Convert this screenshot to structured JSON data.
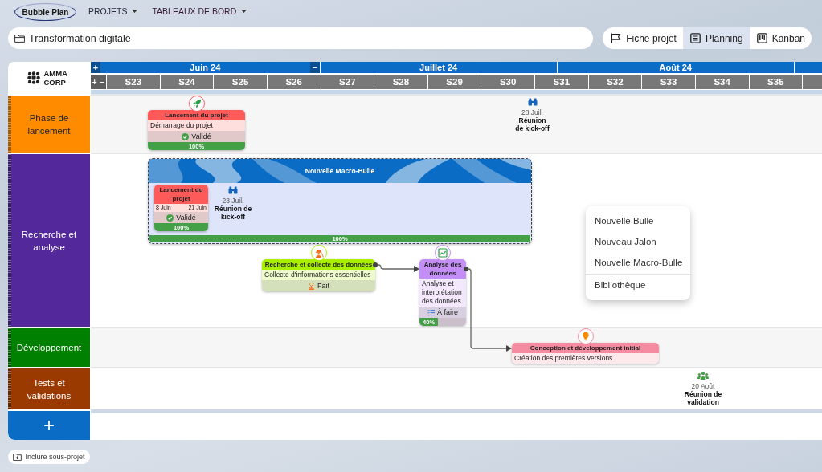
{
  "nav": {
    "logo": "Bubble Plan",
    "menus": [
      {
        "label": "PROJETS"
      },
      {
        "label": "TABLEAUX DE BORD"
      }
    ]
  },
  "project_field": {
    "value": "Transformation digitale"
  },
  "views": [
    {
      "label": "Fiche projet",
      "selected": false
    },
    {
      "label": "Planning",
      "selected": true
    },
    {
      "label": "Kanban",
      "selected": false
    }
  ],
  "company": {
    "name": "AMMA CORP"
  },
  "timeline": {
    "month_buttons": [
      "+",
      "−"
    ],
    "months": [
      "Juin 24",
      "Juillet 24",
      "Août 24"
    ],
    "week_buttons": [
      "+",
      "−"
    ],
    "weeks": [
      "S23",
      "S24",
      "S25",
      "S26",
      "S27",
      "S28",
      "S29",
      "S30",
      "S31",
      "S32",
      "S33",
      "S34",
      "S35"
    ]
  },
  "lanes": [
    {
      "label": "Phase de lancement",
      "color": "#ff8c00",
      "items": [
        {
          "kind": "bubble",
          "title": "Lancement du projet",
          "color": "#ff5a5a",
          "description": "Démarrage du projet",
          "status": {
            "kind": "validated",
            "label": "Validé"
          },
          "progress": {
            "level": 1,
            "label": "100%"
          }
        },
        {
          "kind": "milestone",
          "date": "28 Juil.",
          "title": "Réunion de kick-off"
        }
      ]
    },
    {
      "label": "Recherche et analyse",
      "color": "#52289a",
      "items": [
        {
          "kind": "macro",
          "title": "Nouvelle Macro-Bulle",
          "color": "#0a6cc4",
          "progress": {
            "level": 1,
            "label": "100%"
          },
          "items": [
            {
              "kind": "bubble",
              "title": "Lancement du projet",
              "color": "#ff5a5a",
              "dates": {
                "start": "8 Juin",
                "end": "21 Juin"
              },
              "status": {
                "kind": "validated",
                "label": "Validé"
              },
              "progress": {
                "level": 1,
                "label": "100%"
              }
            },
            {
              "kind": "milestone",
              "date": "28 Juil.",
              "title": "Réunion de kick-off"
            }
          ]
        },
        {
          "kind": "bubble",
          "title": "Recherche et collecte des données",
          "color": "#a8f000",
          "description": "Collecte d'informations essentielles",
          "status": {
            "kind": "done",
            "label": "Fait"
          }
        },
        {
          "kind": "bubble",
          "title": "Analyse des données",
          "color": "#c48ef7",
          "description": "Analyse et interprétation des données",
          "status": {
            "kind": "todo",
            "label": "À faire"
          },
          "progress": {
            "level": 0.4,
            "label": "40%"
          }
        }
      ]
    },
    {
      "label": "Développement",
      "color": "#008000",
      "items": [
        {
          "kind": "bubble",
          "title": "Conception et développement initial",
          "color": "#f48ba0",
          "description": "Création des premières versions"
        }
      ]
    },
    {
      "label": "Tests et validations",
      "color": "#9a3a00",
      "items": [
        {
          "kind": "milestone",
          "date": "20 Août",
          "title": "Réunion de validation"
        }
      ]
    }
  ],
  "add_lane_button": "+",
  "context_menu": {
    "groups": [
      [
        "Nouvelle Bulle",
        "Nouveau Jalon",
        "Nouvelle Macro-Bulle"
      ],
      [
        "Bibliothèque"
      ]
    ]
  },
  "footer": {
    "button": "Inclure sous-projet"
  }
}
